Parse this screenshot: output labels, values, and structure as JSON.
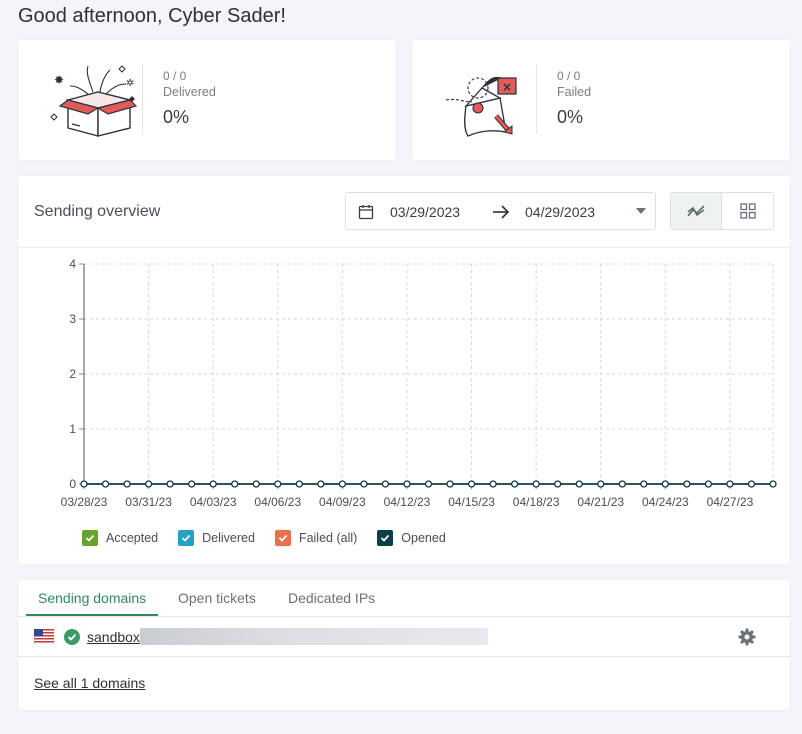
{
  "header": {
    "greeting": "Good afternoon, Cyber Sader!"
  },
  "stats": {
    "delivered": {
      "fraction": "0 / 0",
      "label": "Delivered",
      "percent": "0%"
    },
    "failed": {
      "fraction": "0 / 0",
      "label": "Failed",
      "percent": "0%"
    }
  },
  "overview": {
    "title": "Sending overview",
    "date_from": "03/29/2023",
    "date_to": "04/29/2023",
    "views": [
      "line-chart-icon",
      "grid-view-icon"
    ]
  },
  "chart_data": {
    "type": "line",
    "y_ticks": [
      "0",
      "1",
      "2",
      "3",
      "4"
    ],
    "ylim": [
      0,
      4
    ],
    "x_tick_labels": [
      "03/28/23",
      "03/31/23",
      "04/03/23",
      "04/06/23",
      "04/09/23",
      "04/12/23",
      "04/15/23",
      "04/18/23",
      "04/21/23",
      "04/24/23",
      "04/27/23"
    ],
    "x_start": "03/28/23",
    "x_end": "04/29/23",
    "series": [
      {
        "name": "Accepted",
        "color": "#6aa22e",
        "values": [
          0,
          0,
          0,
          0,
          0,
          0,
          0,
          0,
          0,
          0,
          0,
          0,
          0,
          0,
          0,
          0,
          0,
          0,
          0,
          0,
          0,
          0,
          0,
          0,
          0,
          0,
          0,
          0,
          0,
          0,
          0,
          0,
          0
        ]
      },
      {
        "name": "Delivered",
        "color": "#26a1c5",
        "values": [
          0,
          0,
          0,
          0,
          0,
          0,
          0,
          0,
          0,
          0,
          0,
          0,
          0,
          0,
          0,
          0,
          0,
          0,
          0,
          0,
          0,
          0,
          0,
          0,
          0,
          0,
          0,
          0,
          0,
          0,
          0,
          0,
          0
        ]
      },
      {
        "name": "Failed (all)",
        "color": "#e8714d",
        "values": [
          0,
          0,
          0,
          0,
          0,
          0,
          0,
          0,
          0,
          0,
          0,
          0,
          0,
          0,
          0,
          0,
          0,
          0,
          0,
          0,
          0,
          0,
          0,
          0,
          0,
          0,
          0,
          0,
          0,
          0,
          0,
          0,
          0
        ]
      },
      {
        "name": "Opened",
        "color": "#0e3d4a",
        "values": [
          0,
          0,
          0,
          0,
          0,
          0,
          0,
          0,
          0,
          0,
          0,
          0,
          0,
          0,
          0,
          0,
          0,
          0,
          0,
          0,
          0,
          0,
          0,
          0,
          0,
          0,
          0,
          0,
          0,
          0,
          0,
          0,
          0
        ]
      }
    ],
    "grid": true,
    "legend_position": "bottom"
  },
  "domains": {
    "tabs": [
      {
        "label": "Sending domains",
        "active": true
      },
      {
        "label": "Open tickets",
        "active": false
      },
      {
        "label": "Dedicated IPs",
        "active": false
      }
    ],
    "rows": [
      {
        "name": "sandbox",
        "flag": "us-flag-icon",
        "status": "verified"
      }
    ],
    "see_all": "See all 1 domains"
  }
}
